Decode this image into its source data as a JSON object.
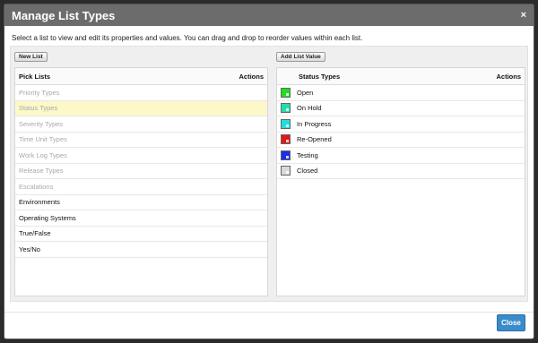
{
  "dialog": {
    "title": "Manage List Types",
    "close_glyph": "×",
    "instructions": "Select a list to view and edit its properties and values. You can drag and drop to reorder values within each list."
  },
  "toolbar": {
    "new_list_label": "New List",
    "add_list_value_label": "Add List Value"
  },
  "pick_lists": {
    "header": "Pick Lists",
    "actions_header": "Actions",
    "items": [
      {
        "label": "Priority Types",
        "state": "muted"
      },
      {
        "label": "Status Types",
        "state": "selected"
      },
      {
        "label": "Severity Types",
        "state": "muted"
      },
      {
        "label": "Time Unit Types",
        "state": "muted"
      },
      {
        "label": "Work Log Types",
        "state": "muted"
      },
      {
        "label": "Release Types",
        "state": "muted"
      },
      {
        "label": "Escalations",
        "state": "muted"
      },
      {
        "label": "Environments",
        "state": "normal"
      },
      {
        "label": "Operating Systems",
        "state": "normal"
      },
      {
        "label": "True/False",
        "state": "normal"
      },
      {
        "label": "Yes/No",
        "state": "normal"
      }
    ]
  },
  "status_types": {
    "header": "Status Types",
    "actions_header": "Actions",
    "items": [
      {
        "label": "Open",
        "color": "#22dd22"
      },
      {
        "label": "On Hold",
        "color": "#22ddaa"
      },
      {
        "label": "In Progress",
        "color": "#22dddd"
      },
      {
        "label": "Re-Opened",
        "color": "#e01818"
      },
      {
        "label": "Testing",
        "color": "#1a2fe6"
      },
      {
        "label": "Closed",
        "color": "#d9d9d9"
      }
    ]
  },
  "footer": {
    "close_label": "Close"
  }
}
